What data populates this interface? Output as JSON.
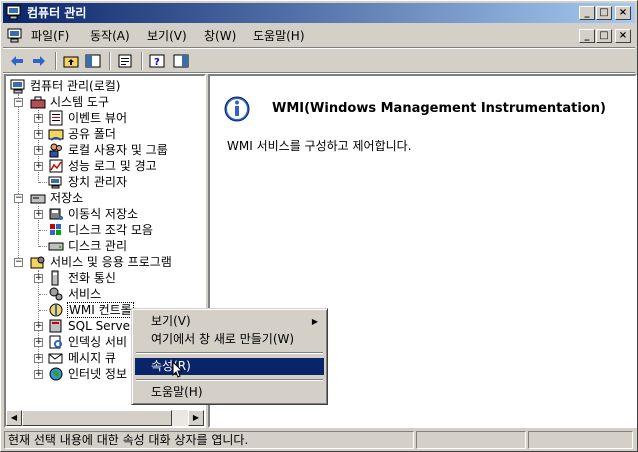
{
  "window": {
    "title": "컴퓨터 관리"
  },
  "title_buttons": {
    "minimize": "_",
    "maximize": "□",
    "close": "×"
  },
  "menu": [
    {
      "label": "파일(F)"
    },
    {
      "label": "동작(A)"
    },
    {
      "label": "보기(V)"
    },
    {
      "label": "창(W)"
    },
    {
      "label": "도움말(H)"
    }
  ],
  "tree": {
    "root": "컴퓨터 관리(로컬)",
    "system_tools": "시스템 도구",
    "event_viewer": "이벤트 뷰어",
    "shared_folders": "공유 폴더",
    "local_users": "로컬 사용자 및 그룹",
    "perf_logs": "성능 로그 및 경고",
    "device_manager": "장치 관리자",
    "storage": "저장소",
    "removable_storage": "이동식 저장소",
    "defrag": "디스크 조각 모음",
    "disk_mgmt": "디스크 관리",
    "services_apps": "서비스 및 응용 프로그램",
    "telephony": "전화 통신",
    "services": "서비스",
    "wmi_control": "WMI 컨트롤",
    "sql_server": "SQL Serve",
    "indexing": "인덱싱 서비",
    "message_queue": "메시지 큐",
    "internet_info": "인터넷 정보"
  },
  "right_pane": {
    "title": "WMI(Windows Management Instrumentation)",
    "description": "WMI 서비스를 구성하고 제어합니다."
  },
  "context_menu": {
    "view": "보기(V)",
    "new_window": "여기에서 창 새로 만들기(W)",
    "properties": "속성(R)",
    "help": "도움말(H)"
  },
  "status": {
    "text": "현재 선택 내용에 대한 속성 대화 상자를 엽니다."
  },
  "colors": {
    "titlebar_start": "#0a246a",
    "titlebar_end": "#a6caf0",
    "highlight": "#0a246a",
    "face": "#d4d0c8"
  }
}
